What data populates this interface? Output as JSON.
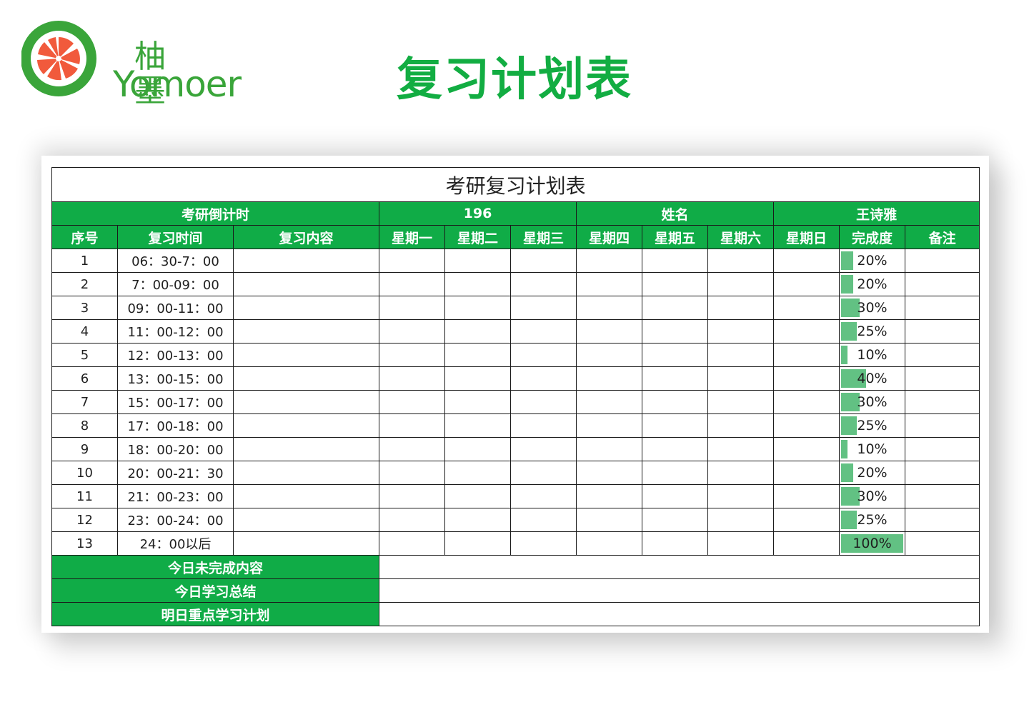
{
  "logo": {
    "chinese": "柚 墨",
    "english": "Yomoer"
  },
  "page_title": "复习计划表",
  "sheet": {
    "caption": "考研复习计划表",
    "countdown_label": "考研倒计时",
    "countdown_value": "196",
    "name_label": "姓名",
    "name_value": "王诗雅",
    "headers": {
      "index": "序号",
      "time": "复习时间",
      "content": "复习内容",
      "mon": "星期一",
      "tue": "星期二",
      "wed": "星期三",
      "thu": "星期四",
      "fri": "星期五",
      "sat": "星期六",
      "sun": "星期日",
      "completion": "完成度",
      "notes": "备注"
    },
    "rows": [
      {
        "index": "1",
        "time": "06：30-7：00",
        "completion": "20%",
        "completion_fraction": 0.2
      },
      {
        "index": "2",
        "time": "7：00-09：00",
        "completion": "20%",
        "completion_fraction": 0.2
      },
      {
        "index": "3",
        "time": "09：00-11：00",
        "completion": "30%",
        "completion_fraction": 0.3
      },
      {
        "index": "4",
        "time": "11：00-12：00",
        "completion": "25%",
        "completion_fraction": 0.25
      },
      {
        "index": "5",
        "time": "12：00-13：00",
        "completion": "10%",
        "completion_fraction": 0.1
      },
      {
        "index": "6",
        "time": "13：00-15：00",
        "completion": "40%",
        "completion_fraction": 0.4
      },
      {
        "index": "7",
        "time": "15：00-17：00",
        "completion": "30%",
        "completion_fraction": 0.3
      },
      {
        "index": "8",
        "time": "17：00-18：00",
        "completion": "25%",
        "completion_fraction": 0.25
      },
      {
        "index": "9",
        "time": "18：00-20：00",
        "completion": "10%",
        "completion_fraction": 0.1
      },
      {
        "index": "10",
        "time": "20：00-21：30",
        "completion": "20%",
        "completion_fraction": 0.2
      },
      {
        "index": "11",
        "time": "21：00-23：00",
        "completion": "30%",
        "completion_fraction": 0.3
      },
      {
        "index": "12",
        "time": "23：00-24：00",
        "completion": "25%",
        "completion_fraction": 0.25
      },
      {
        "index": "13",
        "time": "24：00以后",
        "completion": "100%",
        "completion_fraction": 1.0
      }
    ],
    "footer": {
      "unfinished_label": "今日未完成内容",
      "summary_label": "今日学习总结",
      "plan_label": "明日重点学习计划"
    }
  },
  "colors": {
    "header_green": "#10ac47",
    "title_green": "#12ad42",
    "bar_green": "#62c183",
    "logo_green": "#3aa53a",
    "logo_orange": "#f15a3c"
  }
}
